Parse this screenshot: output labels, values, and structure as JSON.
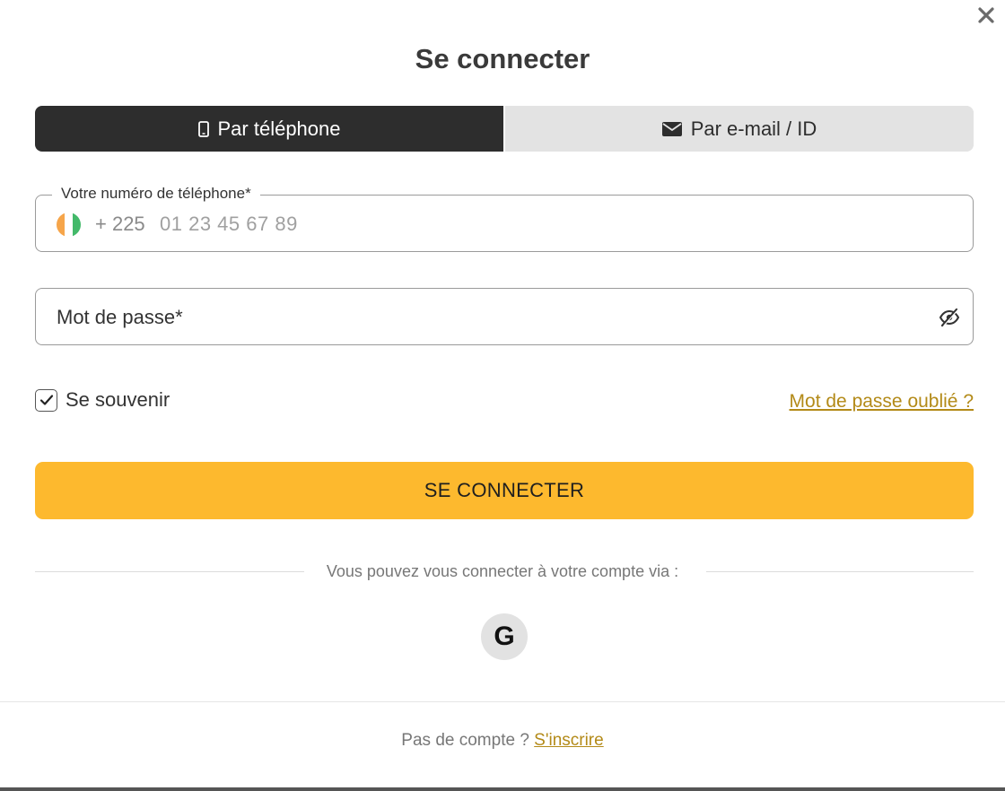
{
  "modal": {
    "title": "Se connecter",
    "close_icon": "close-icon"
  },
  "tabs": [
    {
      "label": "Par téléphone",
      "icon": "mobile-phone-icon",
      "active": true
    },
    {
      "label": "Par e-mail / ID",
      "icon": "envelope-icon",
      "active": false
    }
  ],
  "phone_field": {
    "label": "Votre numéro de téléphone*",
    "country_flag": "cote-divoire-flag-icon",
    "prefix": "+ 225",
    "placeholder": "01 23 45 67 89",
    "value": ""
  },
  "password_field": {
    "placeholder": "Mot de passe*",
    "value": "",
    "toggle_icon": "eye-slash-icon"
  },
  "remember": {
    "label": "Se souvenir",
    "checked": true
  },
  "forgot_password": "Mot de passe oublié ?",
  "submit_label": "SE CONNECTER",
  "social": {
    "divider_text": "Vous pouvez vous connecter à votre compte via :",
    "google_letter": "G"
  },
  "footer": {
    "text": "Pas de compte ?",
    "link": "S'inscrire"
  },
  "colors": {
    "accent": "#fdb92e",
    "link": "#b38a18",
    "tab_active": "#2d2d2d",
    "tab_inactive": "#e3e3e3"
  }
}
